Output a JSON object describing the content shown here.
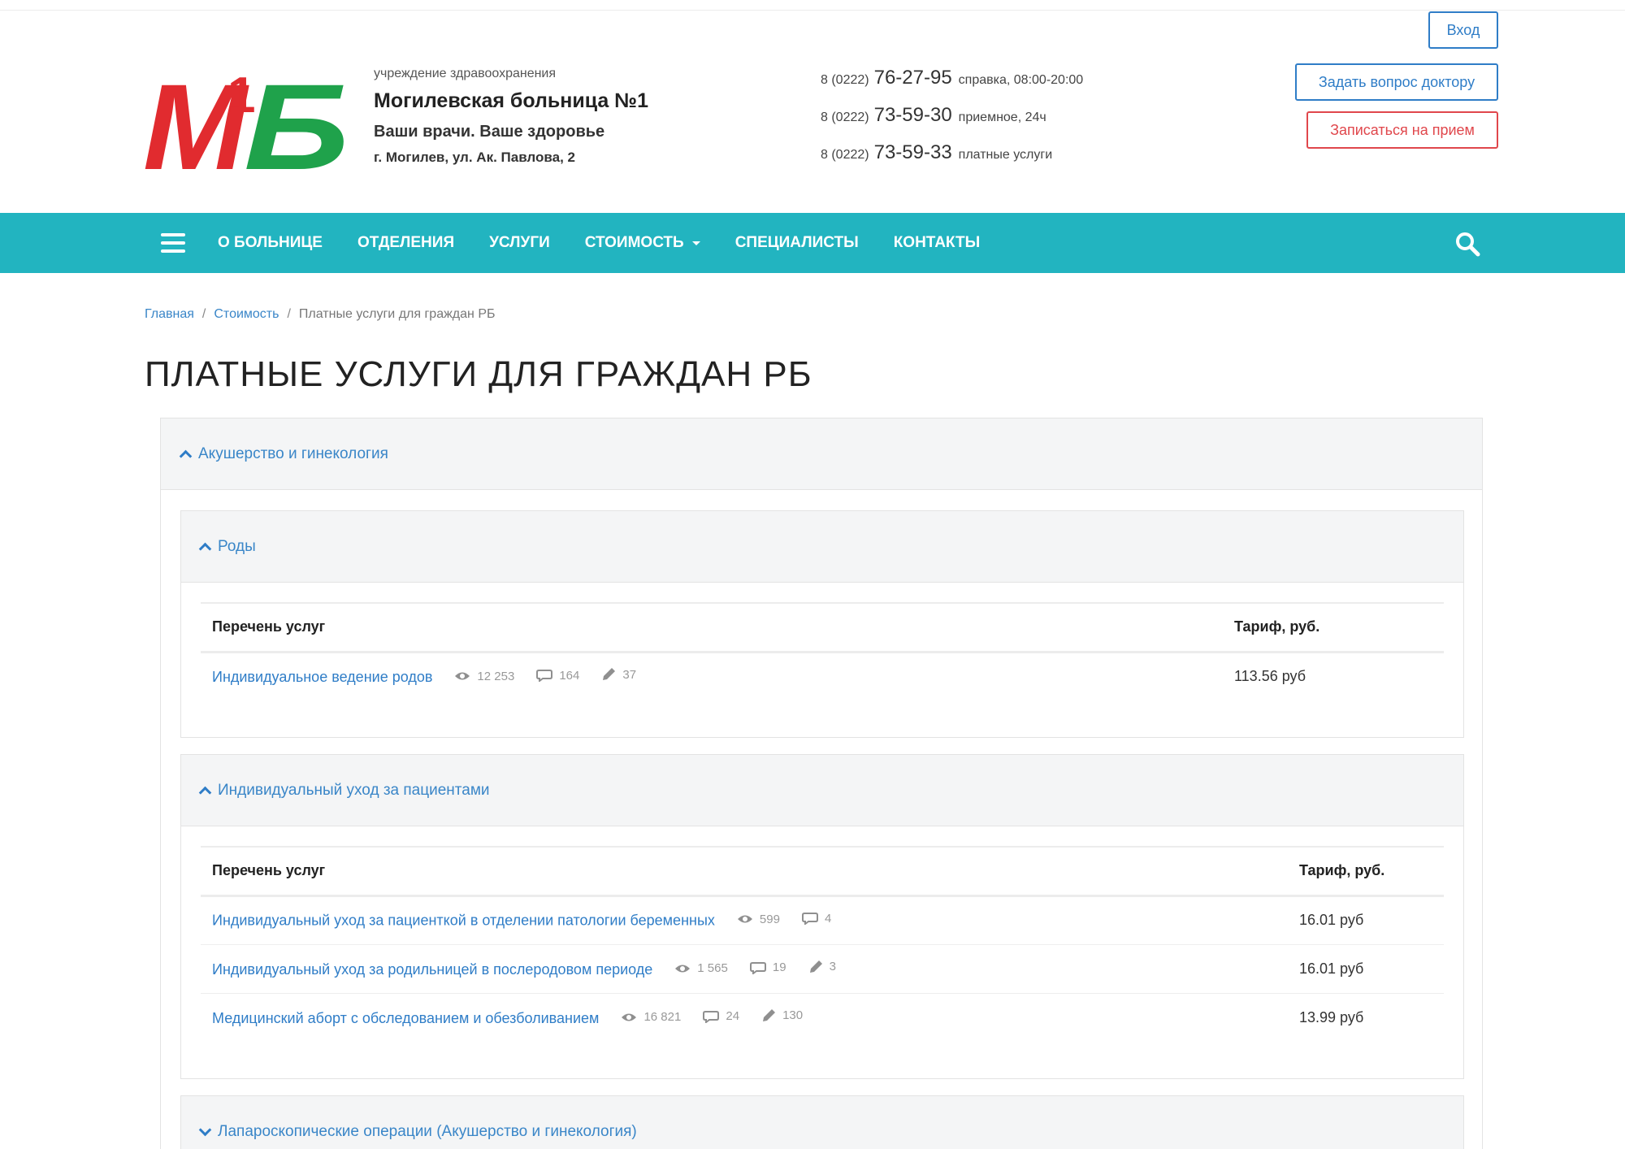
{
  "header": {
    "logo_text": "М1Б",
    "org_kind": "учреждение здравоохранения",
    "org_name": "Могилевская больница №1",
    "slogan": "Ваши врачи. Ваше здоровье",
    "address": "г. Могилев, ул. Ак. Павлова, 2",
    "phones": [
      {
        "code": "8 (0222)",
        "number": "76-27-95",
        "desc": "справка, 08:00-20:00"
      },
      {
        "code": "8 (0222)",
        "number": "73-59-30",
        "desc": "приемное, 24ч"
      },
      {
        "code": "8 (0222)",
        "number": "73-59-33",
        "desc": "платные услуги"
      }
    ],
    "login_label": "Вход",
    "ask_label": "Задать вопрос доктору",
    "book_label": "Записаться на прием"
  },
  "nav": {
    "items": [
      "О БОЛЬНИЦЕ",
      "ОТДЕЛЕНИЯ",
      "УСЛУГИ",
      "СТОИМОСТЬ",
      "СПЕЦИАЛИСТЫ",
      "КОНТАКТЫ"
    ]
  },
  "breadcrumb": {
    "home": "Главная",
    "parent": "Стоимость",
    "sep": "/",
    "current": "Платные услуги для граждан РБ"
  },
  "page_title": "ПЛАТНЫЕ УСЛУГИ ДЛЯ ГРАЖДАН РБ",
  "category": {
    "title": "Акушерство и гинекология",
    "sections": [
      {
        "title": "Роды",
        "col_service": "Перечень услуг",
        "col_price": "Тариф, руб.",
        "rows": [
          {
            "name": "Индивидуальное ведение родов",
            "views": "12 253",
            "comments": "164",
            "edits": "37",
            "price": "113.56 руб"
          }
        ]
      },
      {
        "title": "Индивидуальный уход за пациентами",
        "col_service": "Перечень услуг",
        "col_price": "Тариф, руб.",
        "rows": [
          {
            "name": "Индивидуальный уход за пациенткой в отделении патологии беременных",
            "views": "599",
            "comments": "4",
            "price": "16.01 руб"
          },
          {
            "name": "Индивидуальный уход за родильницей в послеродовом периоде",
            "views": "1 565",
            "comments": "19",
            "edits": "3",
            "price": "16.01 руб"
          },
          {
            "name": "Медицинский аборт с обследованием и обезболиванием",
            "views": "16 821",
            "comments": "24",
            "edits": "130",
            "price": "13.99 руб"
          }
        ]
      },
      {
        "title": "Лапароскопические операции (Акушерство и гинекология)"
      }
    ]
  },
  "colors": {
    "accent": "#22b4c0",
    "link": "#2f7dc7",
    "logo_red": "#e12b2f",
    "logo_green": "#1fa24b",
    "book_red": "#e0474c"
  }
}
